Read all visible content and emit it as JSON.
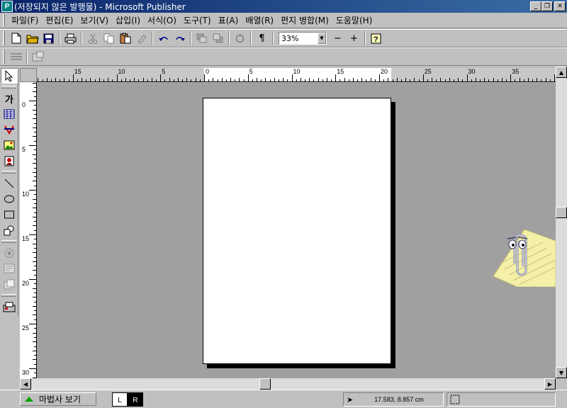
{
  "window": {
    "title": "(저장되지 않은 발행물) - Microsoft Publisher",
    "icon_label": "P",
    "minimize": "_",
    "restore": "❐",
    "close": "✕"
  },
  "menu": [
    "파일(F)",
    "편집(E)",
    "보기(V)",
    "삽입(I)",
    "서식(O)",
    "도구(T)",
    "표(A)",
    "배열(R)",
    "편지 병합(M)",
    "도움말(H)"
  ],
  "toolbar": {
    "zoom_value": "33%",
    "zoom_out": "−",
    "zoom_in": "+",
    "pilcrow": "¶"
  },
  "rulers": {
    "h_labels": [
      "15",
      "10",
      "5",
      "0",
      "5",
      "10",
      "15",
      "20",
      "25",
      "30",
      "35"
    ],
    "v_labels": [
      "0",
      "5",
      "10",
      "15",
      "20",
      "25",
      "30"
    ]
  },
  "toolbox": {
    "text_tool": "가"
  },
  "status": {
    "wizard_label": "마법사 보기",
    "page_left": "L",
    "page_right": "R",
    "position": "17.583, 8.857 cm"
  },
  "colors": {
    "title_gradient_start": "#0a246a",
    "title_gradient_end": "#3a6ea5",
    "workspace": "#a0a0a0",
    "chrome": "#c0c0c0"
  }
}
